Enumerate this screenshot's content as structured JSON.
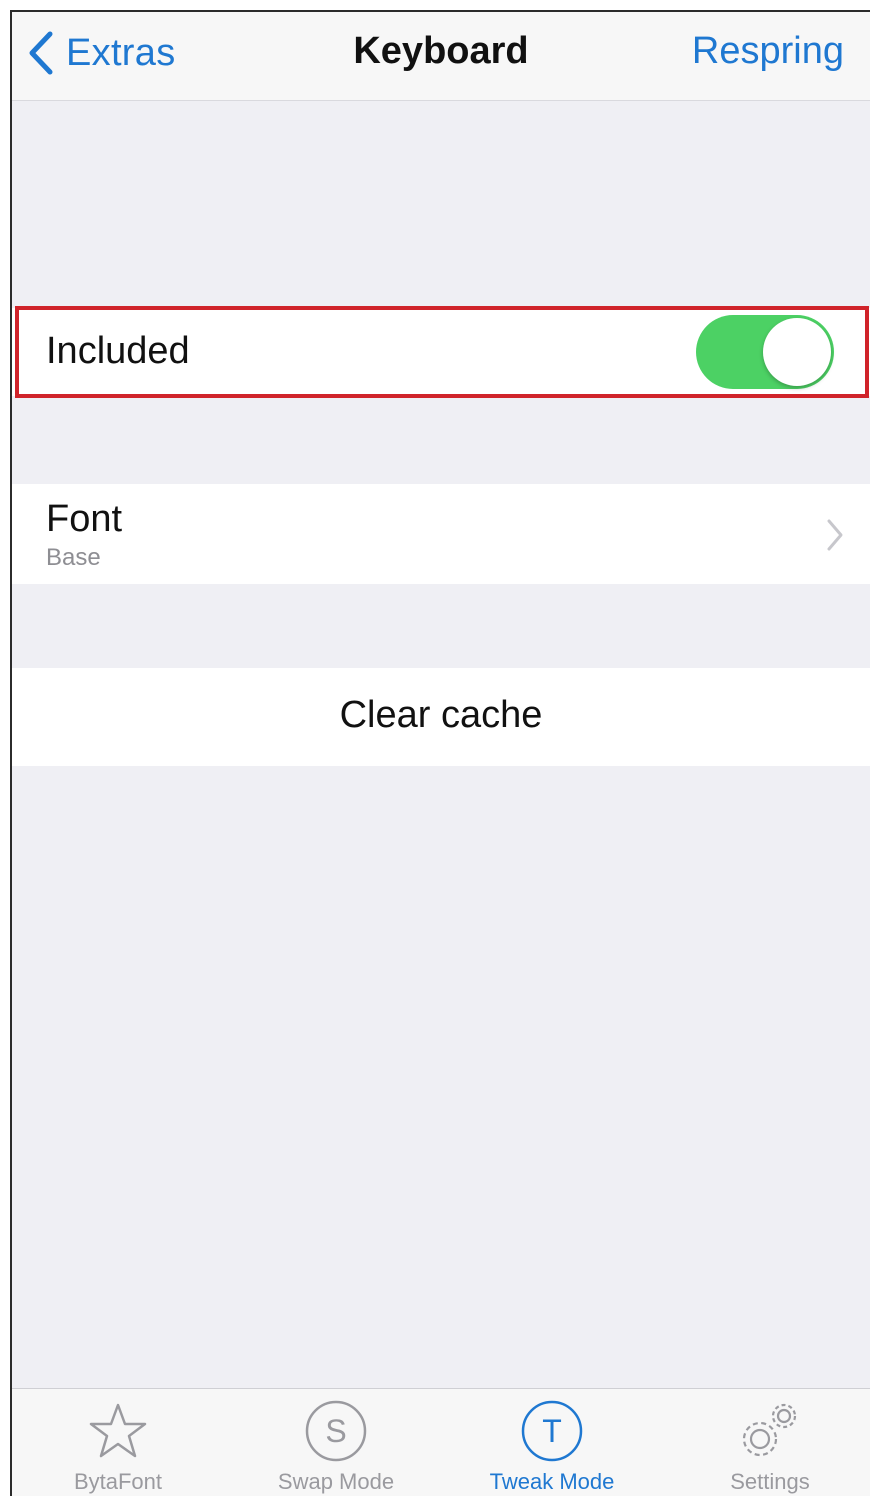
{
  "navbar": {
    "back_label": "Extras",
    "title": "Keyboard",
    "action_label": "Respring"
  },
  "settings": {
    "included": {
      "label": "Included",
      "enabled": true
    },
    "font": {
      "label": "Font",
      "value": "Base"
    },
    "clear_cache": {
      "label": "Clear cache"
    }
  },
  "tabbar": {
    "tabs": [
      {
        "label": "BytaFont",
        "icon": "star-icon",
        "active": false
      },
      {
        "label": "Swap Mode",
        "icon": "s-circle-icon",
        "active": false
      },
      {
        "label": "Tweak Mode",
        "icon": "t-circle-icon",
        "active": true
      },
      {
        "label": "Settings",
        "icon": "gears-icon",
        "active": false
      }
    ]
  },
  "colors": {
    "accent": "#1f78d1",
    "toggle_on": "#4cd164",
    "highlight": "#d0232a",
    "background": "#efeff4"
  }
}
